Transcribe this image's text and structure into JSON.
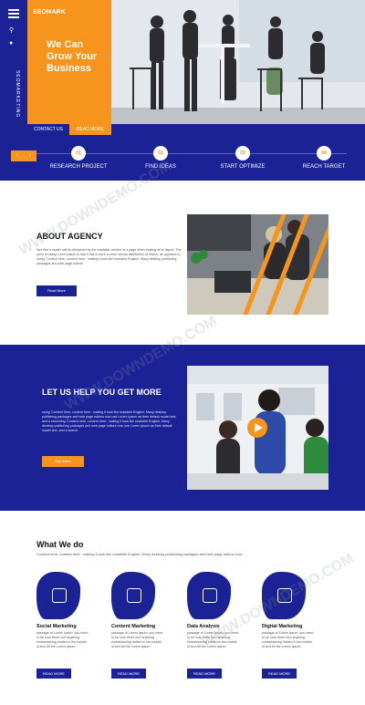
{
  "hero": {
    "brand": "SEOMARK",
    "headline": "We Can Grow Your Business",
    "vertical_brand": "SEOMARKETING",
    "contact_button": "CONTACT US",
    "read_more_button": "READ MORE"
  },
  "steps": [
    {
      "num": "01",
      "label": "RESEARCH PROJECT"
    },
    {
      "num": "02",
      "label": "FIND IDEAS"
    },
    {
      "num": "03",
      "label": "START OPTIMIZE"
    },
    {
      "num": "04",
      "label": "REACH TARGET"
    }
  ],
  "about": {
    "title": "ABOUT AGENCY",
    "text": "fact that a reader will be distracted by the readable content of a page when looking at its layout. The point of using Lorem Ipsum is that it has a more-or-less normal distribution of letters, as opposed to using 'Content here, content here', making it look like readable English. Many desktop publishing packages and web page editors",
    "button": "Read More"
  },
  "help": {
    "title": "LET US HELP YOU GET MORE",
    "text": "using 'Content here, content here', making it look like readable English. Many desktop publishing packages and web page editors now use Lorem Ipsum as their default model text, and a searching 'Content here, content here', making it look like readable English. Many desktop publishing packages and web page editors now use Lorem Ipsum as their default model text, and a search",
    "button": "See More"
  },
  "services": {
    "title": "What We do",
    "subtitle": "Content here, content here', making it look like readable English. Many desktop publishing packages and web page editors now",
    "cards": [
      {
        "title": "Social Marketing",
        "text": "passage of Lorem Ipsum, you need to be sure there isn't anything embarrassing hidden in the middle of text All the Lorem Ipsum",
        "button": "READ MORE"
      },
      {
        "title": "Content Marketing",
        "text": "passage of Lorem Ipsum, you need to be sure there isn't anything embarrassing hidden in the middle of text All the Lorem Ipsum",
        "button": "READ MORE"
      },
      {
        "title": "Data Analysis",
        "text": "passage of Lorem Ipsum, you need to be sure there isn't anything embarrassing hidden in the middle of text All the Lorem Ipsum",
        "button": "READ MORE"
      },
      {
        "title": "Digital Marketing",
        "text": "passage of Lorem Ipsum, you need to be sure there isn't anything embarrassing hidden in the middle of text All the Lorem Ipsum",
        "button": "READ MORE"
      }
    ]
  },
  "watermark": "WWW.DOWNDEMO.COM",
  "colors": {
    "navy": "#1a2296",
    "orange": "#f7941d"
  }
}
